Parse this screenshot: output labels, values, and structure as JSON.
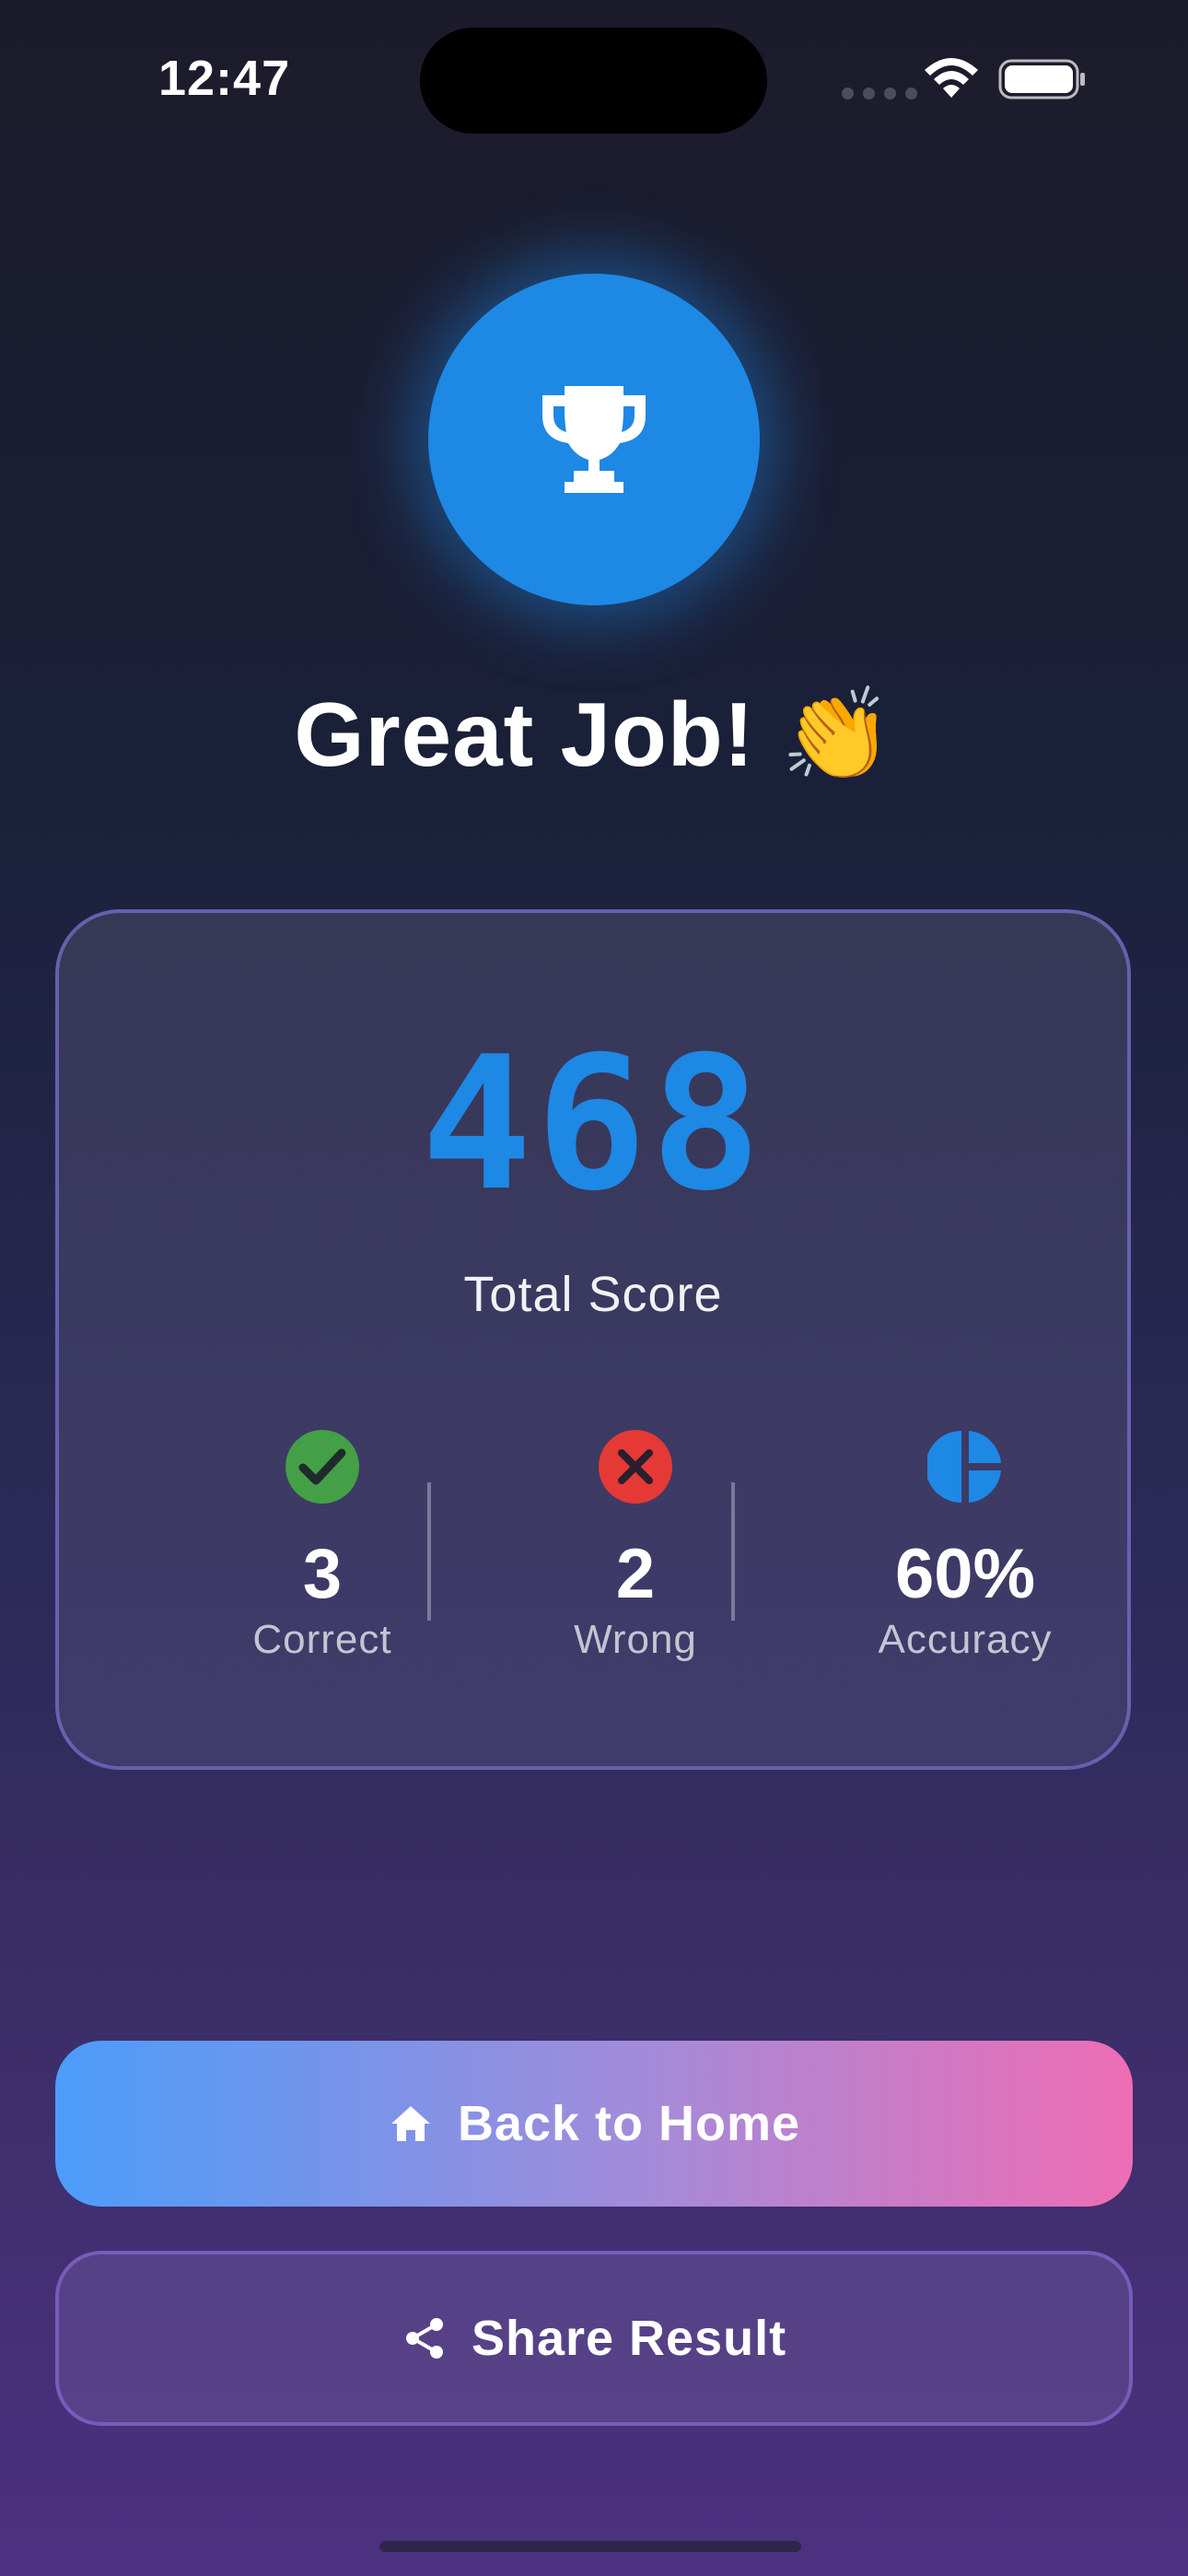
{
  "status_bar": {
    "time": "12:47",
    "icons": [
      "cellular-signal-icon",
      "wifi-icon",
      "battery-icon"
    ]
  },
  "hero": {
    "icon": "trophy-icon",
    "headline": "Great Job! 👏"
  },
  "score_card": {
    "score": "468",
    "score_label": "Total Score",
    "stats": [
      {
        "icon": "check-circle-icon",
        "value": "3",
        "label": "Correct",
        "color": "#43a047"
      },
      {
        "icon": "cancel-circle-icon",
        "value": "2",
        "label": "Wrong",
        "color": "#e53935"
      },
      {
        "icon": "pie-chart-icon",
        "value": "60%",
        "label": "Accuracy",
        "color": "#1e88e5"
      }
    ]
  },
  "actions": {
    "home": {
      "label": "Back to Home",
      "icon": "home-icon"
    },
    "share": {
      "label": "Share Result",
      "icon": "share-icon"
    }
  },
  "colors": {
    "accent": "#1e88e5",
    "success": "#43a047",
    "error": "#e53935",
    "gradient_start": "#4b9dfa",
    "gradient_end": "#ee6db4"
  }
}
